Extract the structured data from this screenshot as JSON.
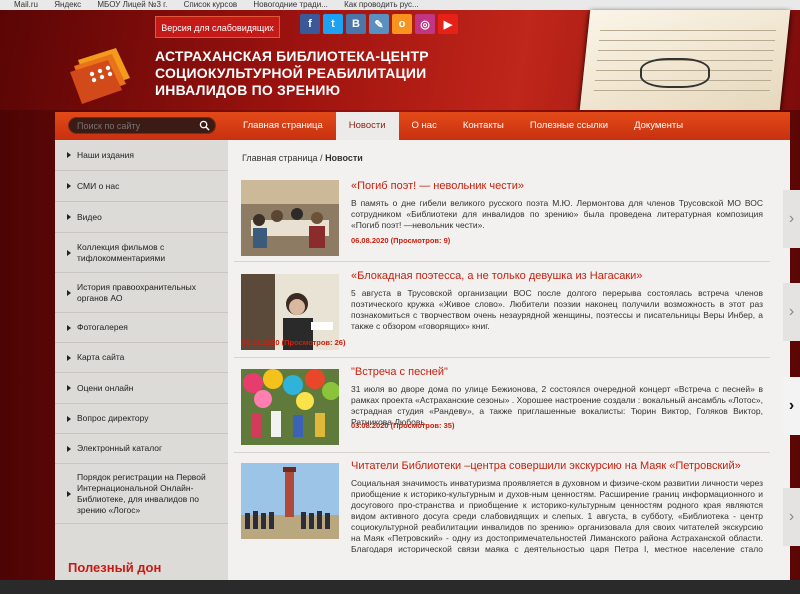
{
  "browser": {
    "bookmarks": [
      "Mail.ru",
      "Яндекс",
      "МБОУ Лицей №3 г.",
      "Список курсов",
      "Новогодние тради...",
      "Как проводить рус..."
    ]
  },
  "header": {
    "vision_button": "Версия для слабовидящих",
    "title_lines": [
      "АСТРАХАНСКАЯ БИБЛИОТЕКА-ЦЕНТР",
      "СОЦИОКУЛЬТУРНОЙ РЕАБИЛИТАЦИИ",
      "ИНВАЛИДОВ ПО ЗРЕНИЮ"
    ],
    "social": [
      {
        "name": "facebook-icon",
        "glyph": "f",
        "color": "#3b5998"
      },
      {
        "name": "twitter-icon",
        "glyph": "t",
        "color": "#1da1f2"
      },
      {
        "name": "vk-icon",
        "glyph": "В",
        "color": "#4a76a8"
      },
      {
        "name": "livejournal-icon",
        "glyph": "✎",
        "color": "#5a8fc0"
      },
      {
        "name": "odnoklassniki-icon",
        "glyph": "о",
        "color": "#f7931e"
      },
      {
        "name": "instagram-icon",
        "glyph": "◎",
        "color": "#c13584"
      },
      {
        "name": "youtube-icon",
        "glyph": "▶",
        "color": "#e62117"
      }
    ]
  },
  "search": {
    "placeholder": "Поиск по сайту"
  },
  "topmenu": [
    {
      "label": "Главная страница",
      "active": false
    },
    {
      "label": "Новости",
      "active": true
    },
    {
      "label": "О нас",
      "active": false
    },
    {
      "label": "Контакты",
      "active": false
    },
    {
      "label": "Полезные ссылки",
      "active": false
    },
    {
      "label": "Документы",
      "active": false
    }
  ],
  "sidebar": {
    "items": [
      "Наши издания",
      "СМИ о нас",
      "Видео",
      "Коллекция фильмов с тифлокомментариями",
      "История правоохранительных органов АО",
      "Фотогалерея",
      "Карта сайта",
      "Оцени онлайн",
      "Вопрос директору",
      "Электронный каталог",
      "Порядок регистрации на Первой Интернациональной Онлайн-Библиотеке, для инвалидов по зрению «Логос»"
    ],
    "block_title": "Полезный дон"
  },
  "breadcrumb": {
    "home": "Главная страница",
    "separator": " / ",
    "current": "Новости"
  },
  "news": [
    {
      "title": "«Погиб поэт! — невольник чести»",
      "text": "В память о дне гибели великого русского поэта М.Ю. Лермонтова для членов Трусовской МО ВОС сотрудником «Библиотеки для инвалидов по зрению» была проведена литературная композиция «Погиб поэт! —невольник чести».",
      "meta": "06.08.2020 (Просмотров: 9)"
    },
    {
      "title": "«Блокадная поэтесса, а не только девушка из Нагасаки»",
      "text": "5 августа в Трусовской организации ВОС после долгого перерыва состоялась встреча членов поэтического кружка «Живое слово». Любители поэзии наконец получили возможность в этот раз познакомиться с творчеством очень незаурядной женщины, поэтессы и писательницы Веры Инбер, а также с обзором «говорящих» книг.",
      "meta": "05.08.2020 (Просмотров: 26)"
    },
    {
      "title": "\"Встреча с песней\"",
      "text": "31 июля во дворе дома по улице Бежионова, 2 состоялся очередной концерт «Встреча с песней» в рамках проекта «Астраханские сезоны» . Хорошее настроение создали : вокальный ансамбль «Лотос», эстрадная студия «Рандеву», а также приглашенные вокалисты: Тюрин Виктор, Голяков Виктор, Ратникова Любовь.",
      "meta": "03.08.2020 (Просмотров: 35)"
    },
    {
      "title": "Читатели Библиотеки –центра совершили экскурсию на Маяк «Петровский»",
      "text": "Социальная значимость инватуризма проявляется в духовном и физиче-ском развитии личности через приобщение к историко-культурным и духов-ным ценностям. Расширение границ информационного и досугового про-странства и приобщение к историко-культурным ценностям родного края являются видом активного досуга среди слабовидящих и слепых. 1 августа, в субботу, «Библиотека - центр социокультурной реабилитации инвалидов по зрению» организовала для своих читателей экскурсию на Маяк «Петровский» - одну из достопримечательностей Лиманского района Астраханской области. Благодаря исторической связи маяка с деятельностью царя Петра I, местное население стало называть его маяком Петра I или «Петровским».",
      "meta": ""
    }
  ],
  "colors": {
    "accent": "#c8210f",
    "nav": "#d9391a",
    "sidebar": "#dddbd8"
  }
}
